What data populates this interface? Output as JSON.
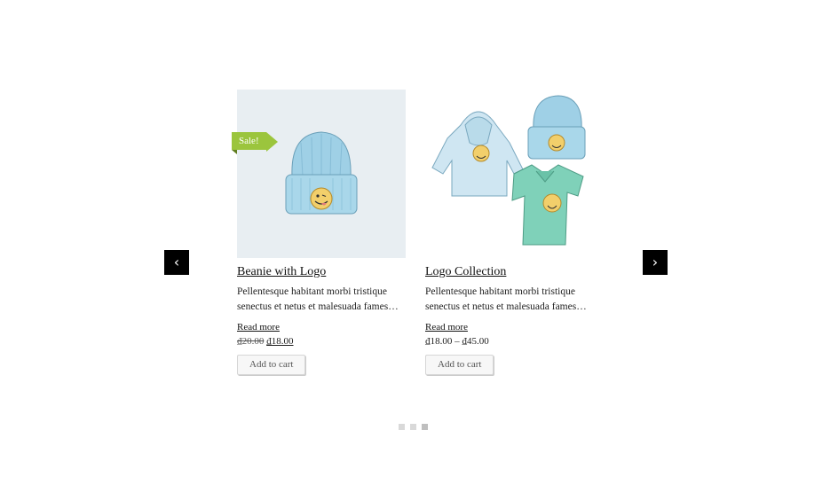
{
  "carousel": {
    "prev_label": "‹",
    "next_label": "›",
    "products": [
      {
        "title": "Beanie with Logo",
        "sale_badge": "Sale!",
        "description": "Pellentesque habitant morbi tristique senectus et netus et malesuada fames…",
        "read_more": "Read more",
        "price_old": "₫20.00",
        "price_new": "₫18.00",
        "add_to_cart": "Add to cart"
      },
      {
        "title": "Logo Collection",
        "description": "Pellentesque habitant morbi tristique senectus et netus et malesuada fames…",
        "read_more": "Read more",
        "price_range": "₫18.00 – ₫45.00",
        "add_to_cart": "Add to cart"
      }
    ],
    "pagination": {
      "count": 3,
      "active_index": 2
    }
  },
  "colors": {
    "sale_badge": "#9bc53d",
    "image_bg": "#e8eef2",
    "beanie": "#9fd0e6",
    "tshirt": "#7fd1b9",
    "hoodie": "#cfe6f2",
    "nav_button": "#000000"
  },
  "icons": {
    "prev": "chevron-left-icon",
    "next": "chevron-right-icon"
  }
}
